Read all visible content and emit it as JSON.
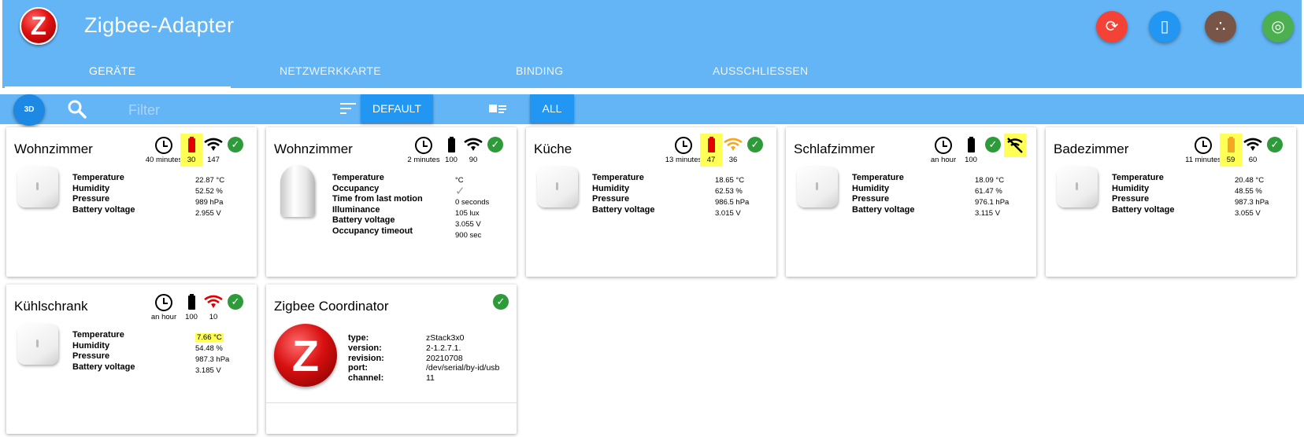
{
  "app": {
    "title": "Zigbee-Adapter",
    "logo_letter": "Z"
  },
  "header_buttons": [
    {
      "name": "refresh-button",
      "icon": "sync-icon",
      "glyph": "⟳",
      "color": "#f44336"
    },
    {
      "name": "install-button",
      "icon": "phone-download-icon",
      "glyph": "▯",
      "color": "#2196f3"
    },
    {
      "name": "group-button",
      "icon": "dots-icon",
      "glyph": "∴",
      "color": "#795548"
    },
    {
      "name": "pairing-button",
      "icon": "radar-icon",
      "glyph": "◎",
      "color": "#4caf50"
    }
  ],
  "tabs": [
    "Geräte",
    "Netzwerkkarte",
    "Binding",
    "Ausschliessen"
  ],
  "toolbar": {
    "btn3d": "3D",
    "filter_placeholder": "Filter",
    "default_label": "Default",
    "all_label": "All"
  },
  "colors": {
    "header": "#64b5f6",
    "button": "#2196f3",
    "ok": "#2e9b3a",
    "highlight": "#ffff55"
  },
  "cards": [
    {
      "name": "Wohnzimmer",
      "last_seen": "40 minutes",
      "battery": "30",
      "battery_color": "#e00000",
      "battery_highlight": true,
      "link": "147",
      "link_color": "#000000",
      "available": true,
      "props": [
        "Temperature",
        "Humidity",
        "Pressure",
        "Battery voltage"
      ],
      "values": [
        "22.87 °C",
        "52.52 %",
        "989 hPa",
        "2.955 V"
      ]
    },
    {
      "name": "Wohnzimmer",
      "last_seen": "2 minutes",
      "battery": "100",
      "battery_color": "#000000",
      "battery_highlight": false,
      "link": "90",
      "link_color": "#000000",
      "available": true,
      "props": [
        "Temperature",
        "Occupancy",
        "Time from last motion",
        "Illuminance",
        "Battery voltage",
        "Occupancy timeout"
      ],
      "values": [
        "°C",
        "✓",
        "0 seconds",
        "105 lux",
        "3.055 V",
        "900 sec"
      ]
    },
    {
      "name": "Küche",
      "last_seen": "13 minutes",
      "battery": "47",
      "battery_color": "#e00000",
      "battery_highlight": true,
      "link": "36",
      "link_color": "#f5a623",
      "available": true,
      "props": [
        "Temperature",
        "Humidity",
        "Pressure",
        "Battery voltage"
      ],
      "values": [
        "18.65 °C",
        "62.53 %",
        "986.5 hPa",
        "3.015 V"
      ]
    },
    {
      "name": "Schlafzimmer",
      "last_seen": "an hour",
      "battery": "100",
      "battery_color": "#000000",
      "battery_highlight": false,
      "available": true,
      "wifi_off_icon": true,
      "props": [
        "Temperature",
        "Humidity",
        "Pressure",
        "Battery voltage"
      ],
      "values": [
        "18.09 °C",
        "61.47 %",
        "976.1 hPa",
        "3.115 V"
      ]
    },
    {
      "name": "Badezimmer",
      "last_seen": "11 minutes",
      "battery": "59",
      "battery_color": "#f5a623",
      "battery_highlight": true,
      "link": "60",
      "link_color": "#000000",
      "available": true,
      "props": [
        "Temperature",
        "Humidity",
        "Pressure",
        "Battery voltage"
      ],
      "values": [
        "20.48 °C",
        "48.55 %",
        "987.3 hPa",
        "3.055 V"
      ]
    },
    {
      "name": "Kühlschrank",
      "last_seen": "an hour",
      "battery": "100",
      "battery_color": "#000000",
      "battery_highlight": false,
      "link": "10",
      "link_color": "#e00000",
      "available": true,
      "temp_highlight": true,
      "props": [
        "Temperature",
        "Humidity",
        "Pressure",
        "Battery voltage"
      ],
      "values": [
        "7.66 °C",
        "54.48 %",
        "987.3 hPa",
        "3.185 V"
      ]
    }
  ],
  "coordinator": {
    "name": "Zigbee Coordinator",
    "props": [
      "type:",
      "version:",
      "revision:",
      "port:",
      "channel:"
    ],
    "values": [
      "zStack3x0",
      "2-1.2.7.1.",
      "20210708",
      "/dev/serial/by-id/usb",
      "11"
    ]
  }
}
